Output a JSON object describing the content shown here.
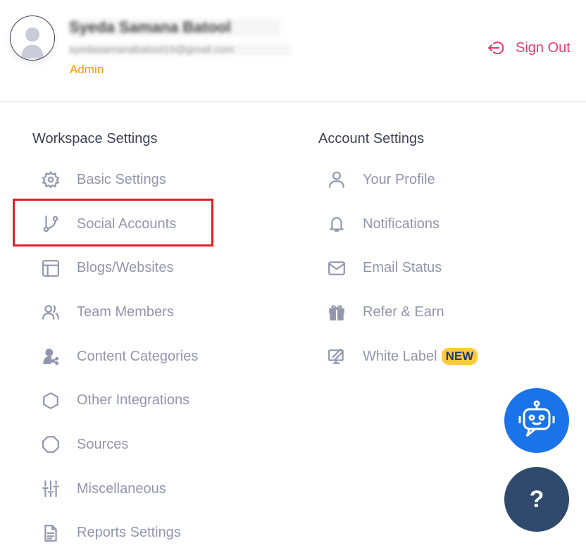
{
  "user": {
    "name": "Syeda Samana Batool",
    "email": "syedasamanabatool19@gmail.com",
    "role": "Admin"
  },
  "sign_out": "Sign Out",
  "workspace": {
    "title": "Workspace Settings",
    "items": [
      {
        "label": "Basic Settings",
        "icon": "gear-icon"
      },
      {
        "label": "Social Accounts",
        "icon": "branch-icon"
      },
      {
        "label": "Blogs/Websites",
        "icon": "layout-icon"
      },
      {
        "label": "Team Members",
        "icon": "users-icon"
      },
      {
        "label": "Content Categories",
        "icon": "user-share-icon"
      },
      {
        "label": "Other Integrations",
        "icon": "hexagon-icon"
      },
      {
        "label": "Sources",
        "icon": "octagon-icon"
      },
      {
        "label": "Miscellaneous",
        "icon": "sliders-icon"
      },
      {
        "label": "Reports Settings",
        "icon": "document-icon"
      }
    ]
  },
  "account": {
    "title": "Account Settings",
    "items": [
      {
        "label": "Your Profile",
        "icon": "user-icon"
      },
      {
        "label": "Notifications",
        "icon": "bell-icon"
      },
      {
        "label": "Email Status",
        "icon": "mail-icon"
      },
      {
        "label": "Refer & Earn",
        "icon": "gift-icon"
      },
      {
        "label": "White Label",
        "icon": "monitor-edit-icon",
        "badge": "NEW"
      }
    ]
  },
  "help": {
    "label": "?"
  },
  "colors": {
    "accent": "#f0386b",
    "role": "#ff9800",
    "highlight": "#e31e24",
    "bot": "#1a73e8",
    "help": "#2f4a6d"
  }
}
